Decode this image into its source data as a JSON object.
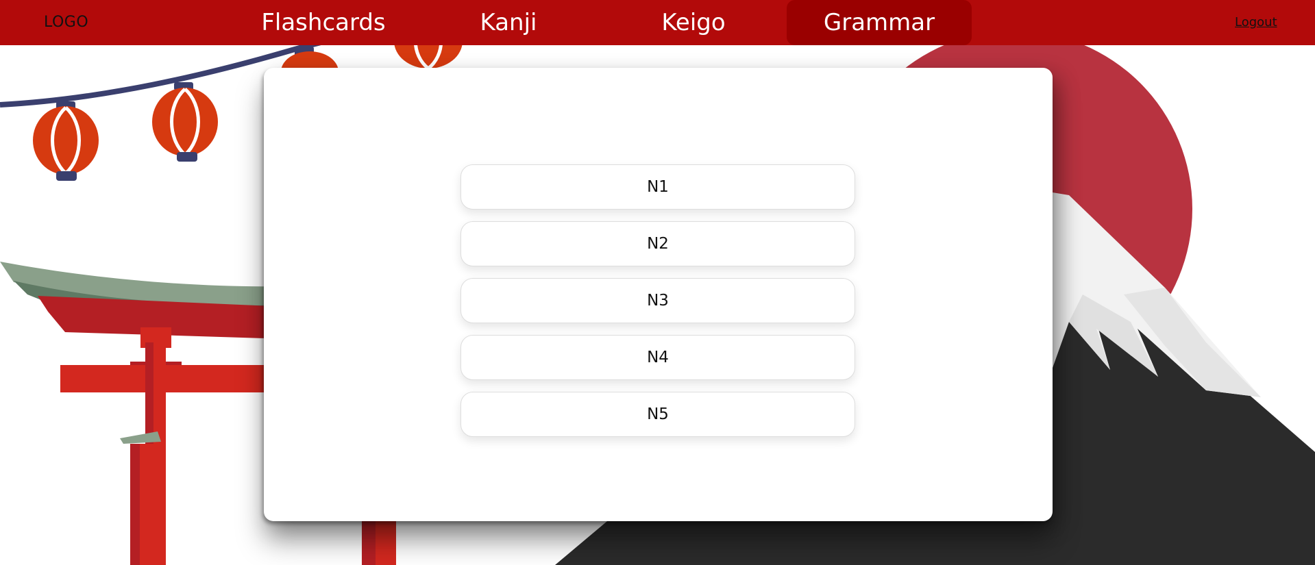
{
  "nav": {
    "logo": "LOGO",
    "items": [
      {
        "label": "Flashcards"
      },
      {
        "label": "Kanji"
      },
      {
        "label": "Keigo"
      },
      {
        "label": "Grammar"
      }
    ],
    "active": "Grammar",
    "logout": "Logout"
  },
  "levels": [
    {
      "label": "N1"
    },
    {
      "label": "N2"
    },
    {
      "label": "N3"
    },
    {
      "label": "N4"
    },
    {
      "label": "N5"
    }
  ],
  "colors": {
    "navbar": "#b20a0a",
    "nav_active": "#9a0000",
    "sun": "#b83340",
    "mountain": "#2b2b2b",
    "snow": "#f2f2f2",
    "torii": "#d3281f",
    "torii_roof": "#8aa08a",
    "lantern": "#d63a10",
    "lantern_cap": "#3a3f6e"
  },
  "icons": [
    "lantern-icon",
    "torii-gate-icon",
    "mountain-icon",
    "sun-icon"
  ]
}
